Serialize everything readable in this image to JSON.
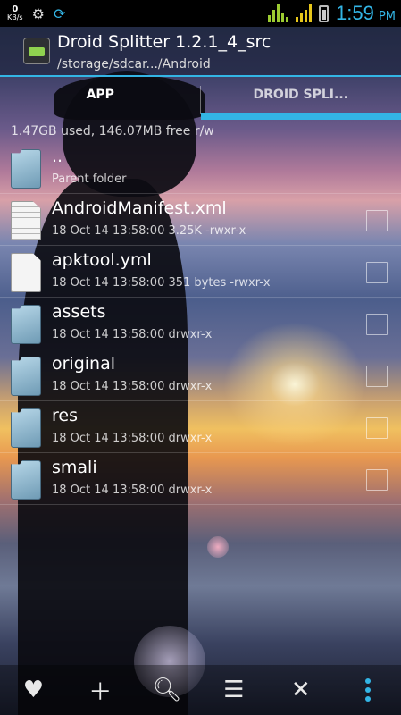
{
  "status_bar": {
    "net_speed_value": "0",
    "net_speed_unit": "KB/s",
    "time": "1:59",
    "ampm": "PM"
  },
  "app_header": {
    "title": "Droid Splitter 1.2.1_4_src",
    "path": "/storage/sdcar.../Android"
  },
  "tabs": [
    {
      "label": "APP",
      "active": true
    },
    {
      "label": "DROID SPLI...",
      "active": false
    }
  ],
  "storage_info": "1.47GB used, 146.07MB free  r/w",
  "files": [
    {
      "name": "..",
      "meta": "Parent folder",
      "type": "folder",
      "checkbox": false
    },
    {
      "name": "AndroidManifest.xml",
      "meta": "18 Oct 14 13:58:00  3.25K  -rwxr-x",
      "type": "xml",
      "checkbox": true
    },
    {
      "name": "apktool.yml",
      "meta": "18 Oct 14 13:58:00  351 bytes  -rwxr-x",
      "type": "file",
      "checkbox": true
    },
    {
      "name": "assets",
      "meta": "18 Oct 14 13:58:00  drwxr-x",
      "type": "folder",
      "checkbox": true
    },
    {
      "name": "original",
      "meta": "18 Oct 14 13:58:00  drwxr-x",
      "type": "folder",
      "checkbox": true
    },
    {
      "name": "res",
      "meta": "18 Oct 14 13:58:00  drwxr-x",
      "type": "folder",
      "checkbox": true
    },
    {
      "name": "smali",
      "meta": "18 Oct 14 13:58:00  drwxr-x",
      "type": "folder",
      "checkbox": true
    }
  ],
  "toolbar": [
    {
      "icon": "heart-icon"
    },
    {
      "icon": "plus-icon"
    },
    {
      "icon": "search-icon"
    },
    {
      "icon": "sort-icon"
    },
    {
      "icon": "close-icon"
    },
    {
      "icon": "overflow-menu-icon"
    }
  ],
  "colors": {
    "accent": "#33b5e5",
    "signal_green": "#9ccc31",
    "signal_yellow": "#e7c61a"
  }
}
